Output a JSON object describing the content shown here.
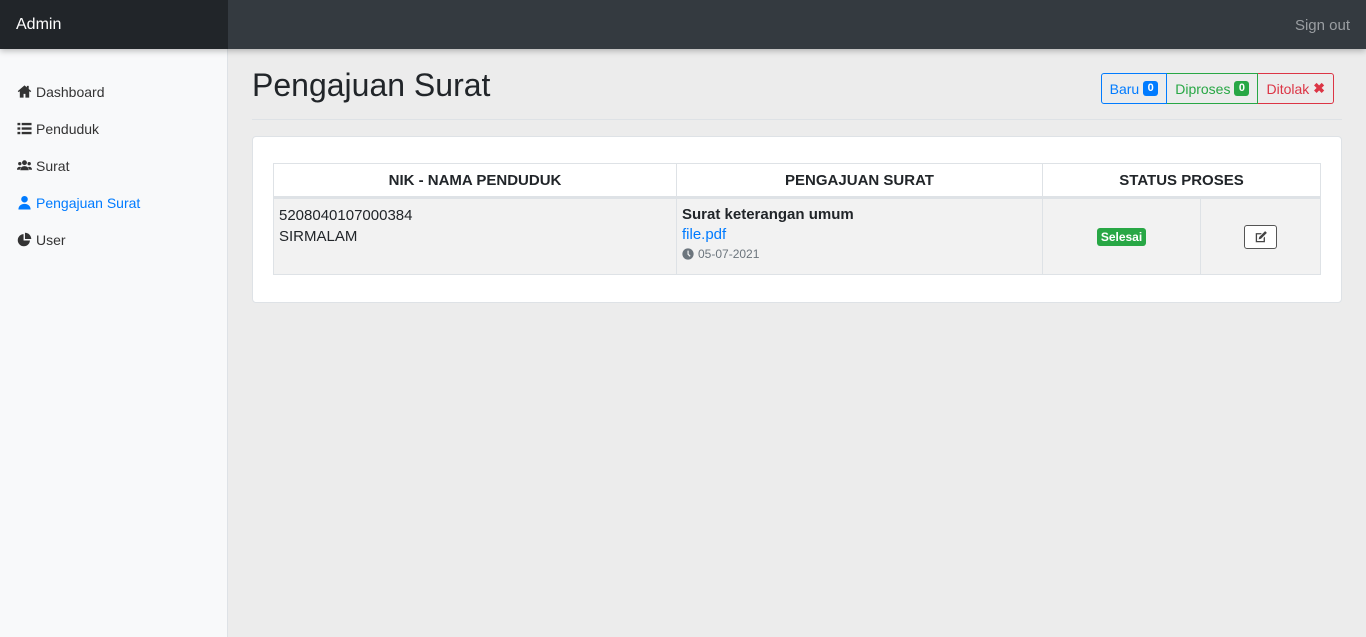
{
  "topbar": {
    "brand": "Admin",
    "signout": "Sign out"
  },
  "sidebar": {
    "items": [
      {
        "label": "Dashboard",
        "icon": "home-icon",
        "active": false
      },
      {
        "label": "Penduduk",
        "icon": "list-icon",
        "active": false
      },
      {
        "label": "Surat",
        "icon": "users-icon",
        "active": false
      },
      {
        "label": "Pengajuan Surat",
        "icon": "user-icon",
        "active": true
      },
      {
        "label": "User",
        "icon": "pie-chart-icon",
        "active": false
      }
    ]
  },
  "page": {
    "title": "Pengajuan Surat"
  },
  "filters": {
    "baru": {
      "label": "Baru",
      "count": "0"
    },
    "diproses": {
      "label": "Diproses",
      "count": "0"
    },
    "ditolak": {
      "label": "Ditolak",
      "icon": "x-icon"
    }
  },
  "table": {
    "headers": [
      "NIK - NAMA PENDUDUK",
      "PENGAJUAN SURAT",
      "STATUS PROSES"
    ],
    "rows": [
      {
        "nik": "5208040107000384",
        "nama": "SIRMALAM",
        "surat": "Surat keterangan umum",
        "file": "file.pdf",
        "date": "05-07-2021",
        "status": "Selesai"
      }
    ]
  },
  "colors": {
    "primary": "#007bff",
    "success": "#28a745",
    "danger": "#dc3545",
    "topbar": "#343a40"
  }
}
